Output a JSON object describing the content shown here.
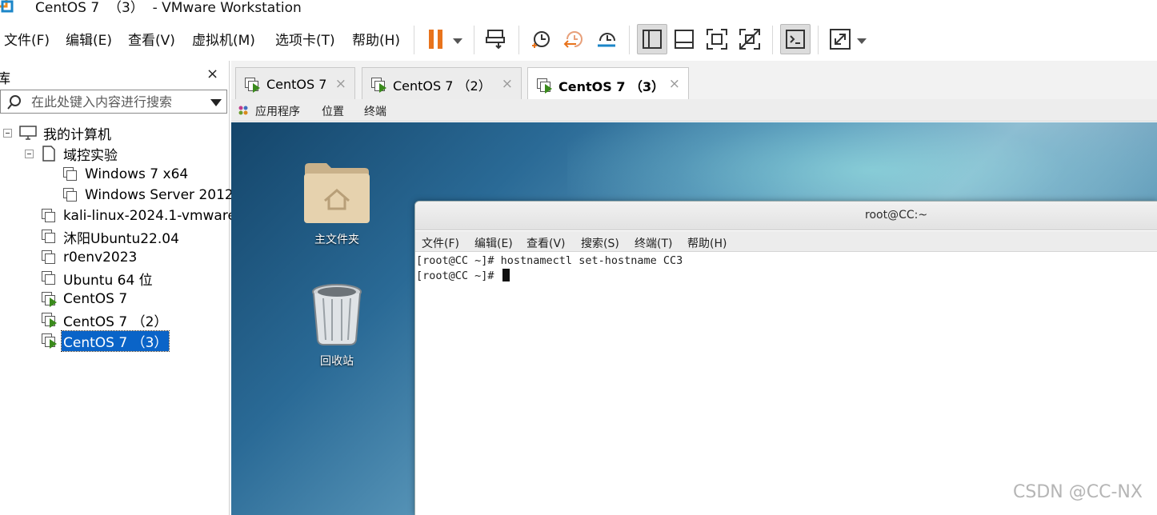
{
  "window": {
    "title": "CentOS 7  （3）  - VMware Workstation"
  },
  "menu": [
    {
      "label": "文件(F)"
    },
    {
      "label": "编辑(E)"
    },
    {
      "label": "查看(V)"
    },
    {
      "label": "虚拟机(M)"
    },
    {
      "label": "选项卡(T)"
    },
    {
      "label": "帮助(H)"
    }
  ],
  "toolbar": {
    "icons": [
      "pause-icon",
      "send-ctrl-alt-del-icon",
      "snapshot-icon",
      "revert-snapshot-icon",
      "snapshot-manager-icon",
      "library-view-icon",
      "thumbnail-bar-icon",
      "full-screen-icon",
      "unity-icon",
      "console-view-icon",
      "stretch-guest-icon"
    ],
    "accent": "#e8731c"
  },
  "library": {
    "title": "库",
    "close": "×",
    "search_placeholder": "在此处键入内容进行搜索",
    "tree": [
      {
        "label": "我的计算机",
        "type": "computer"
      },
      {
        "label": "域控实验",
        "type": "folder"
      },
      {
        "label": "Windows 7 x64",
        "type": "vm"
      },
      {
        "label": "Windows Server 2012",
        "type": "vm"
      },
      {
        "label": "kali-linux-2024.1-vmware",
        "type": "vm"
      },
      {
        "label": "沐阳Ubuntu22.04",
        "type": "vm"
      },
      {
        "label": "r0env2023",
        "type": "vm"
      },
      {
        "label": "Ubuntu 64 位",
        "type": "vm"
      },
      {
        "label": "CentOS 7",
        "type": "vm-running"
      },
      {
        "label": "CentOS 7  （2）",
        "type": "vm-running"
      },
      {
        "label": "CentOS 7  （3）",
        "type": "vm-running",
        "selected": true
      }
    ]
  },
  "tabs": [
    {
      "label": "CentOS 7"
    },
    {
      "label": "CentOS 7 （2）"
    },
    {
      "label": "CentOS 7 （3）",
      "active": true
    }
  ],
  "tab_close": "×",
  "guest_bar": {
    "apps": "应用程序",
    "places": "位置",
    "terminal": "终端"
  },
  "desktop": {
    "icons": [
      {
        "label": "主文件夹"
      },
      {
        "label": "回收站"
      }
    ]
  },
  "terminal": {
    "title": "root@CC:~",
    "menu": [
      "文件(F)",
      "编辑(E)",
      "查看(V)",
      "搜索(S)",
      "终端(T)",
      "帮助(H)"
    ],
    "lines": [
      "[root@CC ~]# hostnamectl set-hostname CC3",
      "[root@CC ~]# "
    ]
  },
  "watermark": "CSDN @CC-NX"
}
